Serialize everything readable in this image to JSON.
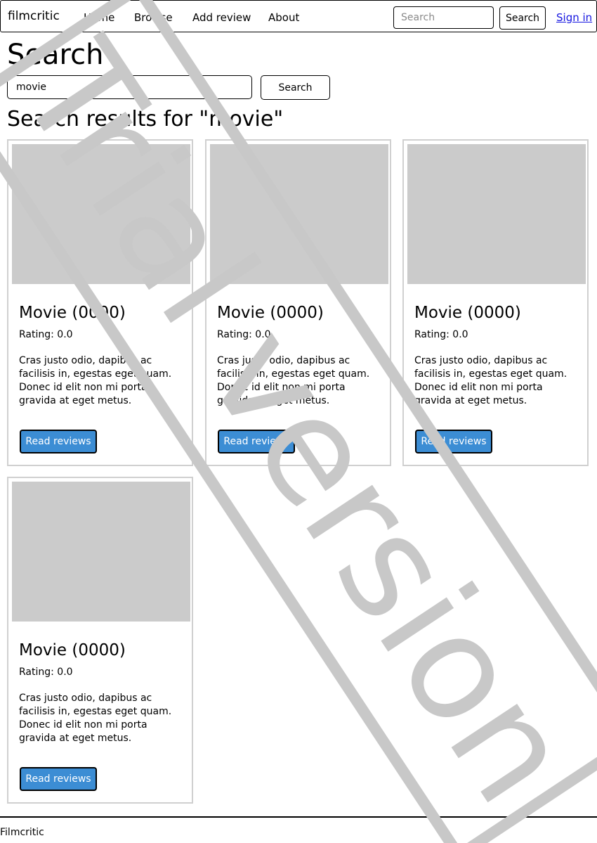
{
  "navbar": {
    "brand": "filmcritic",
    "links": [
      "Home",
      "Browse",
      "Add review",
      "About"
    ],
    "search_placeholder": "Search",
    "search_button": "Search",
    "signin": "Sign in"
  },
  "page": {
    "title": "Search",
    "search_value": "movie",
    "search_button": "Search",
    "results_heading": "Search results for \"movie\""
  },
  "results": [
    {
      "title": "Movie (0000)",
      "rating": "Rating: 0.0",
      "text": "Cras justo odio, dapibus ac facilisis in, egestas eget quam. Donec id elit non mi porta gravida at eget metus.",
      "button": "Read reviews"
    },
    {
      "title": "Movie (0000)",
      "rating": "Rating: 0.0",
      "text": "Cras justo odio, dapibus ac facilisis in, egestas eget quam. Donec id elit non mi porta gravida at eget metus.",
      "button": "Read reviews"
    },
    {
      "title": "Movie (0000)",
      "rating": "Rating: 0.0",
      "text": "Cras justo odio, dapibus ac facilisis in, egestas eget quam. Donec id elit non mi porta gravida at eget metus.",
      "button": "Read reviews"
    },
    {
      "title": "Movie (0000)",
      "rating": "Rating: 0.0",
      "text": "Cras justo odio, dapibus ac facilisis in, egestas eget quam. Donec id elit non mi porta gravida at eget metus.",
      "button": "Read reviews"
    }
  ],
  "footer": {
    "text": "Filmcritic"
  },
  "watermark": {
    "text": "Trial version"
  },
  "colors": {
    "button_primary": "#3c8dd4",
    "placeholder_image": "#cbcbcb",
    "watermark": "#c8c8c8",
    "link": "#1515e0"
  }
}
